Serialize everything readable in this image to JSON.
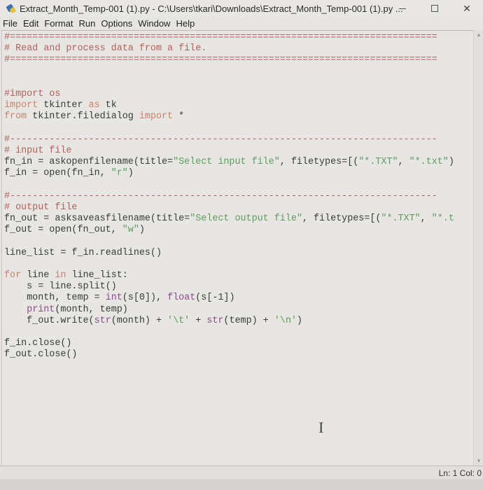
{
  "window": {
    "title": "Extract_Month_Temp-001 (1).py - C:\\Users\\tkari\\Downloads\\Extract_Month_Temp-001 (1).py ...",
    "icon": "python-idle-icon",
    "controls": {
      "minimize": "minimize-icon",
      "maximize": "maximize-icon",
      "close_glyph": "✕"
    }
  },
  "menubar": {
    "items": [
      "File",
      "Edit",
      "Format",
      "Run",
      "Options",
      "Window",
      "Help"
    ]
  },
  "editor": {
    "lines": [
      [
        {
          "t": "#============================================================================",
          "c": "cmt"
        }
      ],
      [
        {
          "t": "# Read and process data from a file.",
          "c": "cmt"
        }
      ],
      [
        {
          "t": "#============================================================================",
          "c": "cmt"
        }
      ],
      [
        {
          "t": "",
          "c": "def"
        }
      ],
      [
        {
          "t": "",
          "c": "def"
        }
      ],
      [
        {
          "t": "#import os",
          "c": "cmt"
        }
      ],
      [
        {
          "t": "import",
          "c": "kw"
        },
        {
          "t": " tkinter ",
          "c": "def"
        },
        {
          "t": "as",
          "c": "kw"
        },
        {
          "t": " tk",
          "c": "def"
        }
      ],
      [
        {
          "t": "from",
          "c": "kw"
        },
        {
          "t": " tkinter.filedialog ",
          "c": "def"
        },
        {
          "t": "import",
          "c": "kw"
        },
        {
          "t": " *",
          "c": "def"
        }
      ],
      [
        {
          "t": "",
          "c": "def"
        }
      ],
      [
        {
          "t": "#----------------------------------------------------------------------------",
          "c": "cmt"
        }
      ],
      [
        {
          "t": "# input file",
          "c": "cmt"
        }
      ],
      [
        {
          "t": "fn_in = askopenfilename(title=",
          "c": "def"
        },
        {
          "t": "\"Select input file\"",
          "c": "str"
        },
        {
          "t": ", filetypes=[(",
          "c": "def"
        },
        {
          "t": "\"*.TXT\"",
          "c": "str"
        },
        {
          "t": ", ",
          "c": "def"
        },
        {
          "t": "\"*.txt\"",
          "c": "str"
        },
        {
          "t": ")",
          "c": "def"
        }
      ],
      [
        {
          "t": "f_in = open(fn_in, ",
          "c": "def"
        },
        {
          "t": "\"r\"",
          "c": "str"
        },
        {
          "t": ")",
          "c": "def"
        }
      ],
      [
        {
          "t": "",
          "c": "def"
        }
      ],
      [
        {
          "t": "#----------------------------------------------------------------------------",
          "c": "cmt"
        }
      ],
      [
        {
          "t": "# output file",
          "c": "cmt"
        }
      ],
      [
        {
          "t": "fn_out = asksaveasfilename(title=",
          "c": "def"
        },
        {
          "t": "\"Select output file\"",
          "c": "str"
        },
        {
          "t": ", filetypes=[(",
          "c": "def"
        },
        {
          "t": "\"*.TXT\"",
          "c": "str"
        },
        {
          "t": ", ",
          "c": "def"
        },
        {
          "t": "\"*.t",
          "c": "str"
        }
      ],
      [
        {
          "t": "f_out = open(fn_out, ",
          "c": "def"
        },
        {
          "t": "\"w\"",
          "c": "str"
        },
        {
          "t": ")",
          "c": "def"
        }
      ],
      [
        {
          "t": "",
          "c": "def"
        }
      ],
      [
        {
          "t": "line_list = f_in.readlines()",
          "c": "def"
        }
      ],
      [
        {
          "t": "",
          "c": "def"
        }
      ],
      [
        {
          "t": "for",
          "c": "kw"
        },
        {
          "t": " line ",
          "c": "def"
        },
        {
          "t": "in",
          "c": "kw"
        },
        {
          "t": " line_list:",
          "c": "def"
        }
      ],
      [
        {
          "t": "    s = line.split()",
          "c": "def"
        }
      ],
      [
        {
          "t": "    month, temp = ",
          "c": "def"
        },
        {
          "t": "int",
          "c": "bi"
        },
        {
          "t": "(s[0]), ",
          "c": "def"
        },
        {
          "t": "float",
          "c": "bi"
        },
        {
          "t": "(s[-1])",
          "c": "def"
        }
      ],
      [
        {
          "t": "    ",
          "c": "def"
        },
        {
          "t": "print",
          "c": "bi"
        },
        {
          "t": "(month, temp)",
          "c": "def"
        }
      ],
      [
        {
          "t": "    f_out.write(",
          "c": "def"
        },
        {
          "t": "str",
          "c": "bi"
        },
        {
          "t": "(month) + ",
          "c": "def"
        },
        {
          "t": "'\\t'",
          "c": "str"
        },
        {
          "t": " + ",
          "c": "def"
        },
        {
          "t": "str",
          "c": "bi"
        },
        {
          "t": "(temp) + ",
          "c": "def"
        },
        {
          "t": "'\\n'",
          "c": "str"
        },
        {
          "t": ")",
          "c": "def"
        }
      ],
      [
        {
          "t": "",
          "c": "def"
        }
      ],
      [
        {
          "t": "f_in.close()",
          "c": "def"
        }
      ],
      [
        {
          "t": "f_out.close()",
          "c": "def"
        }
      ]
    ]
  },
  "statusbar": {
    "position": "Ln: 1  Col: 0"
  },
  "cursor": {
    "glyph": "I"
  },
  "colors": {
    "comment": "#b0605a",
    "keyword": "#c9806e",
    "string": "#5f9a5f",
    "builtin": "#8a4c8a",
    "default": "#3a3a3a"
  }
}
